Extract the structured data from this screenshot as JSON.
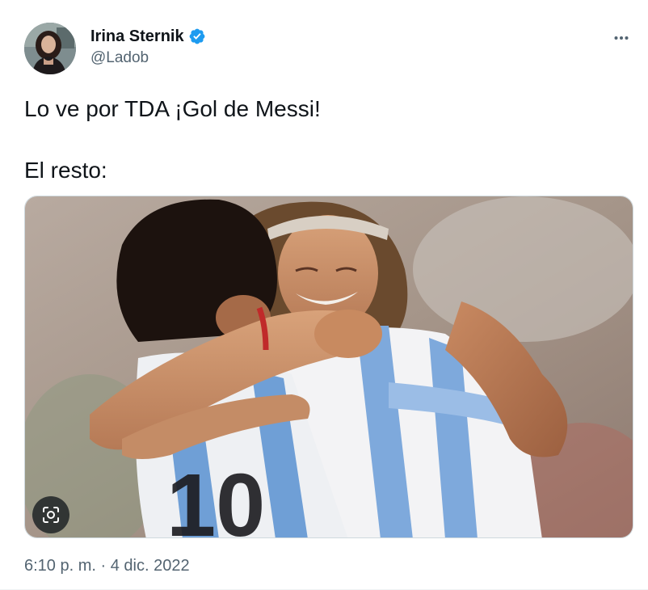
{
  "author": {
    "display_name": "Irina Sternik",
    "handle": "@Ladob",
    "verified": true,
    "avatar_icon": "profile-photo"
  },
  "more_icon": "more-horizontal-icon",
  "tweet": {
    "line1": "Lo ve por TDA ¡Gol de Messi!",
    "line2": "El resto:"
  },
  "media": {
    "type": "photo",
    "alt_button_icon": "image-recognition-icon"
  },
  "meta": {
    "time": "6:10 p. m.",
    "separator": "·",
    "date": "4 dic. 2022"
  },
  "colors": {
    "verified": "#1d9bf0",
    "secondary_text": "#536471",
    "border": "#cfd9de"
  }
}
